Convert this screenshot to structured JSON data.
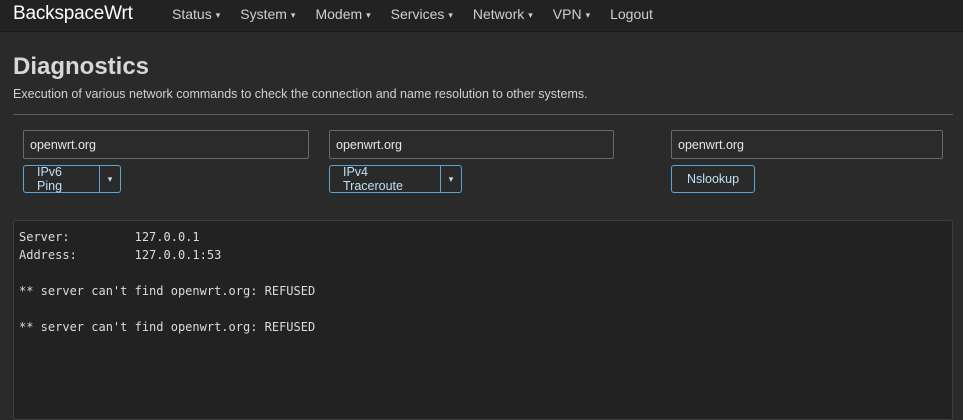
{
  "brand": "BackspaceWrt",
  "menu": [
    {
      "label": "Status",
      "caret": "▾"
    },
    {
      "label": "System",
      "caret": "▾"
    },
    {
      "label": "Modem",
      "caret": "▾"
    },
    {
      "label": "Services",
      "caret": "▾"
    },
    {
      "label": "Network",
      "caret": "▾"
    },
    {
      "label": "VPN",
      "caret": "▾"
    },
    {
      "label": "Logout",
      "caret": ""
    }
  ],
  "page": {
    "title": "Diagnostics",
    "description": "Execution of various network commands to check the connection and name resolution to other systems."
  },
  "tools": {
    "ping": {
      "host": "openwrt.org",
      "button": "IPv6 Ping",
      "dropdown": "▾"
    },
    "traceroute": {
      "host": "openwrt.org",
      "button": "IPv4 Traceroute",
      "dropdown": "▾"
    },
    "nslookup": {
      "host": "openwrt.org",
      "button": "Nslookup"
    }
  },
  "output": {
    "lines": [
      "Server:         127.0.0.1",
      "Address:        127.0.0.1:53",
      "",
      "** server can't find openwrt.org: REFUSED",
      "",
      "** server can't find openwrt.org: REFUSED"
    ]
  },
  "colors": {
    "background": "#2a2a2a",
    "navbar": "#222222",
    "button_border": "#5aa6d6"
  }
}
